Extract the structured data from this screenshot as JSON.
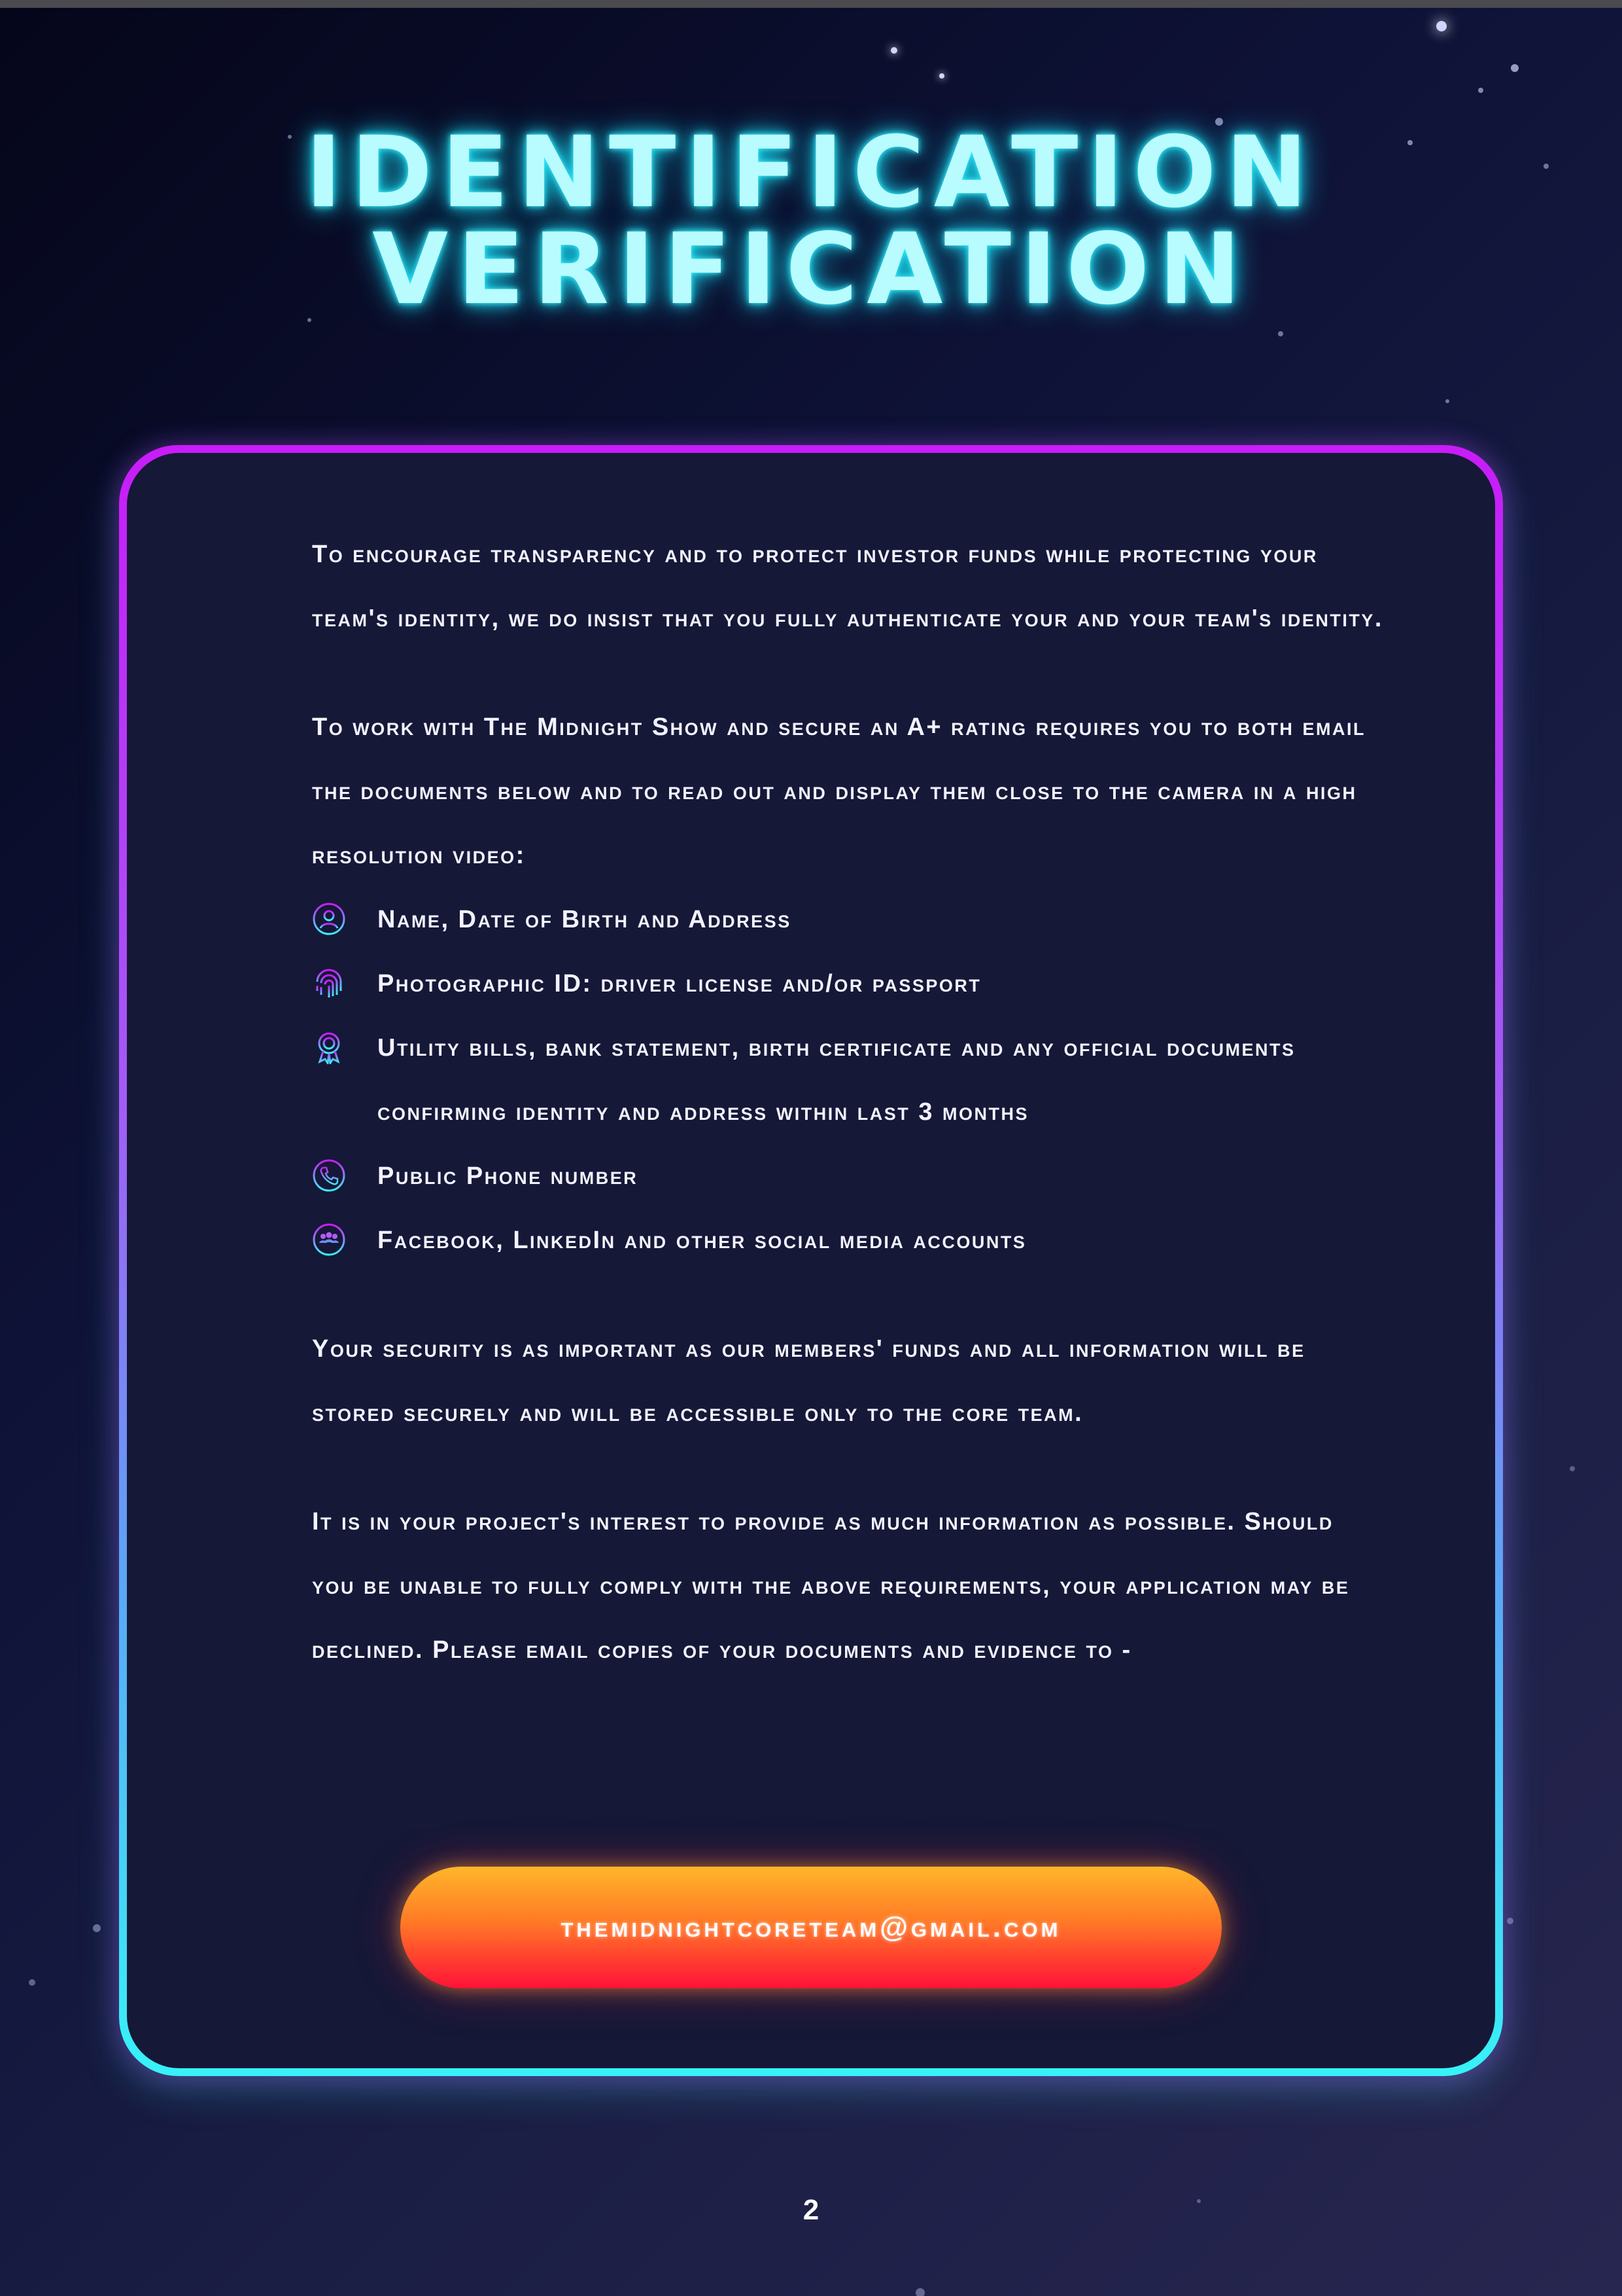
{
  "title": {
    "line1": "Identification",
    "line2": "Verification"
  },
  "intro": "To encourage transparency and to protect investor funds while protecting your team's identity, we do insist that you fully authenticate your and your team's identity.",
  "requirement_text": "To work with The Midnight Show and secure an A+ rating requires you to both email the documents below and to read out and display them close to the camera in a high resolution video:",
  "documents": [
    {
      "icon": "user-icon",
      "label": "Name, Date of Birth and Address"
    },
    {
      "icon": "fingerprint-icon",
      "label": "Photographic ID: driver license and/or passport"
    },
    {
      "icon": "award-badge-icon",
      "label": "Utility bills, bank statement, birth certificate and any official documents confirming identity and address within last 3 months"
    },
    {
      "icon": "phone-icon",
      "label": "Public Phone number"
    },
    {
      "icon": "group-icon",
      "label": "Facebook, LinkedIn and other social media accounts"
    }
  ],
  "security_text": "Your security is as important as our members' funds and all information will be stored securely and will be accessible only to the core team.",
  "interest_text": "It is in your project's interest to provide as much information as possible. Should you be unable to fully comply with the above requirements, your application may be declined. Please email copies of your documents and evidence to -",
  "email_button": "themidnightcoreteam@gmail.com",
  "page_number": "2",
  "colors": {
    "title_glow": "#3ff0ff",
    "border_top": "#c81cf8",
    "border_bottom": "#37f2f7",
    "button_top": "#ffb62a",
    "button_bottom": "#ff1237",
    "background": "#0e1236"
  }
}
